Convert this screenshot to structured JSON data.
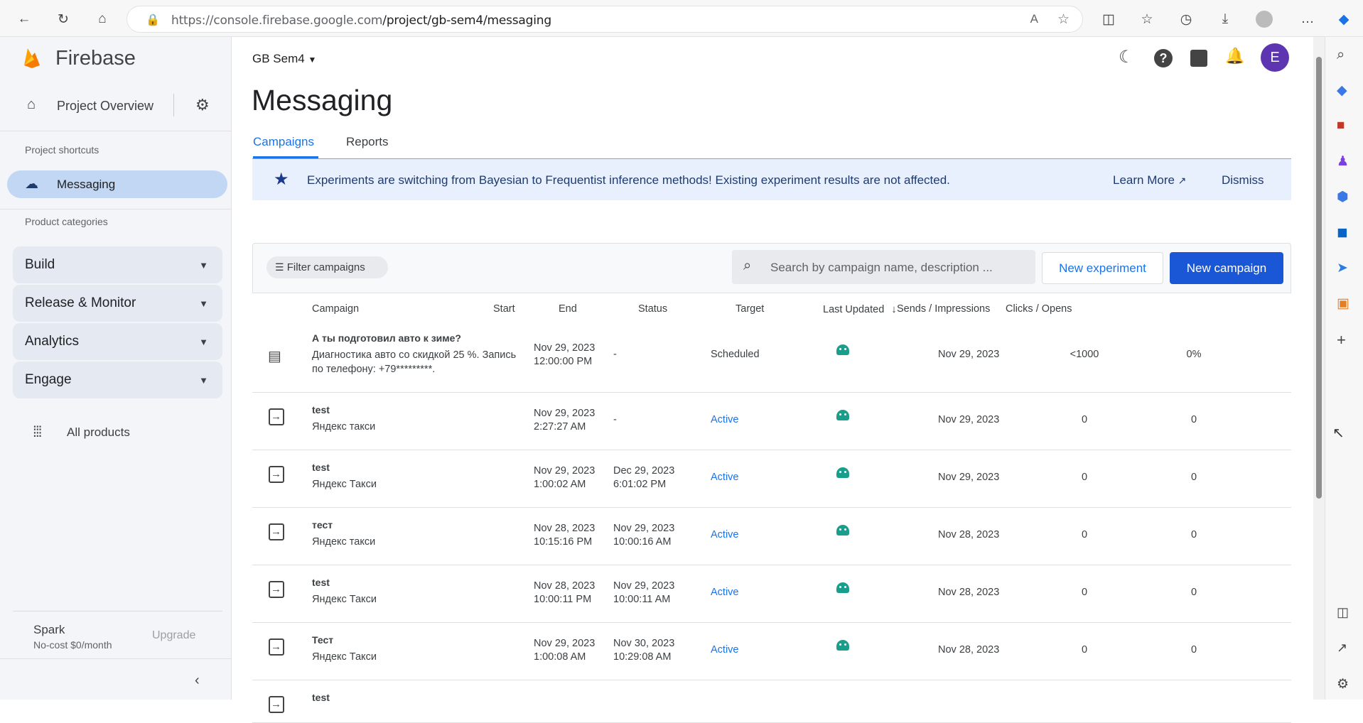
{
  "browser": {
    "url_host": "https://console.firebase.google.com",
    "url_path": "/project/gb-sem4/messaging"
  },
  "sidebar": {
    "brand": "Firebase",
    "project_overview": "Project Overview",
    "shortcuts_label": "Project shortcuts",
    "active_item": "Messaging",
    "categories_label": "Product categories",
    "categories": [
      "Build",
      "Release & Monitor",
      "Analytics",
      "Engage"
    ],
    "all_products": "All products",
    "plan_name": "Spark",
    "plan_desc": "No-cost $0/month",
    "upgrade": "Upgrade"
  },
  "header": {
    "project": "GB Sem4",
    "avatar_letter": "E",
    "page_title": "Messaging",
    "tabs": [
      "Campaigns",
      "Reports"
    ]
  },
  "banner": {
    "text": "Experiments are switching from Bayesian to Frequentist inference methods! Existing experiment results are not affected.",
    "learn_more": "Learn More",
    "dismiss": "Dismiss"
  },
  "toolbar": {
    "filter": "Filter campaigns",
    "search_placeholder": "Search by campaign name, description ...",
    "new_experiment": "New experiment",
    "new_campaign": "New campaign"
  },
  "table": {
    "headers": [
      "Campaign",
      "Start",
      "End",
      "Status",
      "Target",
      "Last Updated",
      "Sends / Impressions",
      "Clicks / Opens"
    ],
    "rows": [
      {
        "title": "А ты подготовил авто к зиме?",
        "desc1": "Диагностика авто со скидкой 25 %. Запись",
        "desc2": "по телефону: +79*********.",
        "start1": "Nov 29, 2023",
        "start2": "12:00:00 PM",
        "end1": "-",
        "end2": "",
        "status": "Scheduled",
        "updated": "Nov 29, 2023",
        "sends": "<1000",
        "clicks": "0%"
      },
      {
        "title": "test",
        "desc1": "Яндекс такси",
        "desc2": "",
        "start1": "Nov 29, 2023",
        "start2": "2:27:27 AM",
        "end1": "-",
        "end2": "",
        "status": "Active",
        "updated": "Nov 29, 2023",
        "sends": "0",
        "clicks": "0"
      },
      {
        "title": "test",
        "desc1": "Яндекс Такси",
        "desc2": "",
        "start1": "Nov 29, 2023",
        "start2": "1:00:02 AM",
        "end1": "Dec 29, 2023",
        "end2": "6:01:02 PM",
        "status": "Active",
        "updated": "Nov 29, 2023",
        "sends": "0",
        "clicks": "0"
      },
      {
        "title": "тест",
        "desc1": "Яндекс такси",
        "desc2": "",
        "start1": "Nov 28, 2023",
        "start2": "10:15:16 PM",
        "end1": "Nov 29, 2023",
        "end2": "10:00:16 AM",
        "status": "Active",
        "updated": "Nov 28, 2023",
        "sends": "0",
        "clicks": "0"
      },
      {
        "title": "test",
        "desc1": "Яндекс Такси",
        "desc2": "",
        "start1": "Nov 28, 2023",
        "start2": "10:00:11 PM",
        "end1": "Nov 29, 2023",
        "end2": "10:00:11 AM",
        "status": "Active",
        "updated": "Nov 28, 2023",
        "sends": "0",
        "clicks": "0"
      },
      {
        "title": "Тест",
        "desc1": "Яндекс Такси",
        "desc2": "",
        "start1": "Nov 29, 2023",
        "start2": "1:00:08 AM",
        "end1": "Nov 30, 2023",
        "end2": "10:29:08 AM",
        "status": "Active",
        "updated": "Nov 28, 2023",
        "sends": "0",
        "clicks": "0"
      },
      {
        "title": "test",
        "desc1": "",
        "desc2": "",
        "start1": "",
        "start2": "",
        "end1": "",
        "end2": "",
        "status": "",
        "updated": "",
        "sends": "",
        "clicks": ""
      }
    ]
  }
}
